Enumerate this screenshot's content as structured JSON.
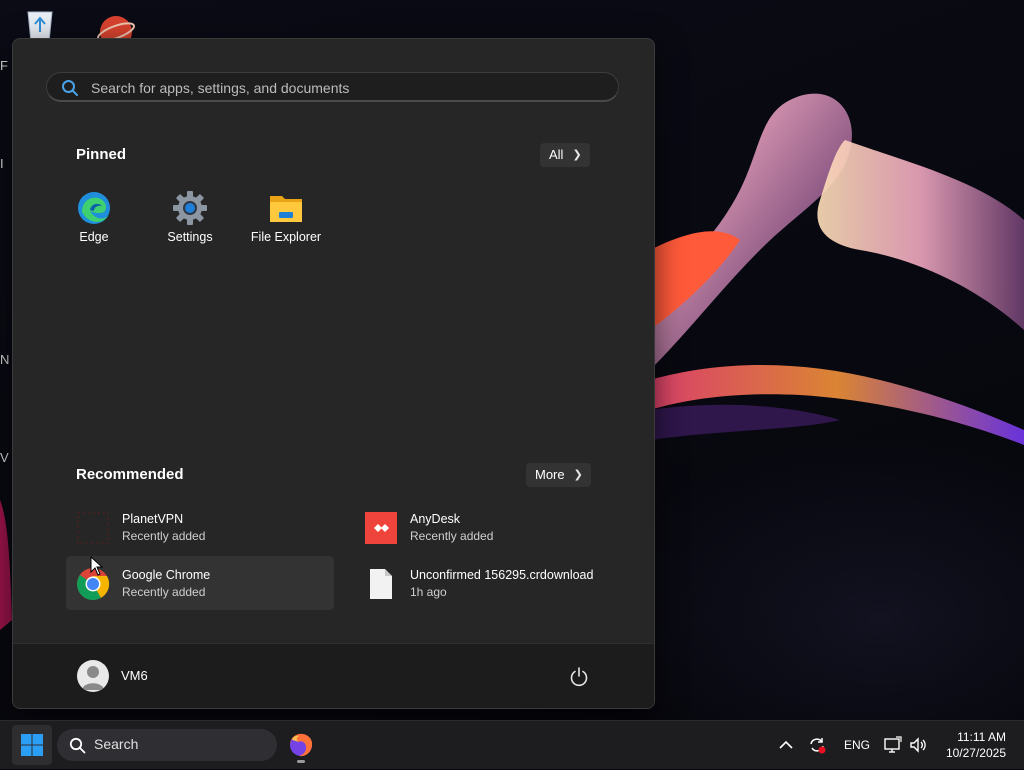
{
  "desktop": {
    "edge_labels": [
      "F",
      "I",
      "N",
      "V"
    ]
  },
  "start_menu": {
    "search": {
      "placeholder": "Search for apps, settings, and documents"
    },
    "pinned": {
      "title": "Pinned",
      "all_button": "All",
      "apps": [
        {
          "label": "Edge",
          "icon": "edge-icon"
        },
        {
          "label": "Settings",
          "icon": "settings-gear-icon"
        },
        {
          "label": "File Explorer",
          "icon": "folder-icon"
        }
      ]
    },
    "recommended": {
      "title": "Recommended",
      "more_button": "More",
      "items": [
        {
          "name": "PlanetVPN",
          "subtitle": "Recently added",
          "icon": "planetvpn-icon"
        },
        {
          "name": "AnyDesk",
          "subtitle": "Recently added",
          "icon": "anydesk-icon"
        },
        {
          "name": "Google Chrome",
          "subtitle": "Recently added",
          "icon": "chrome-icon"
        },
        {
          "name": "Unconfirmed 156295.crdownload",
          "subtitle": "1h ago",
          "icon": "file-icon"
        }
      ]
    },
    "user": {
      "name": "VM6"
    }
  },
  "taskbar": {
    "search_label": "Search",
    "tray": {
      "language": "ENG",
      "time": "11:11 AM",
      "date": "10/27/2025"
    }
  },
  "colors": {
    "menu_bg": "#262626",
    "accent_blue": "#0078d4",
    "anydesk_red": "#ef443b"
  }
}
